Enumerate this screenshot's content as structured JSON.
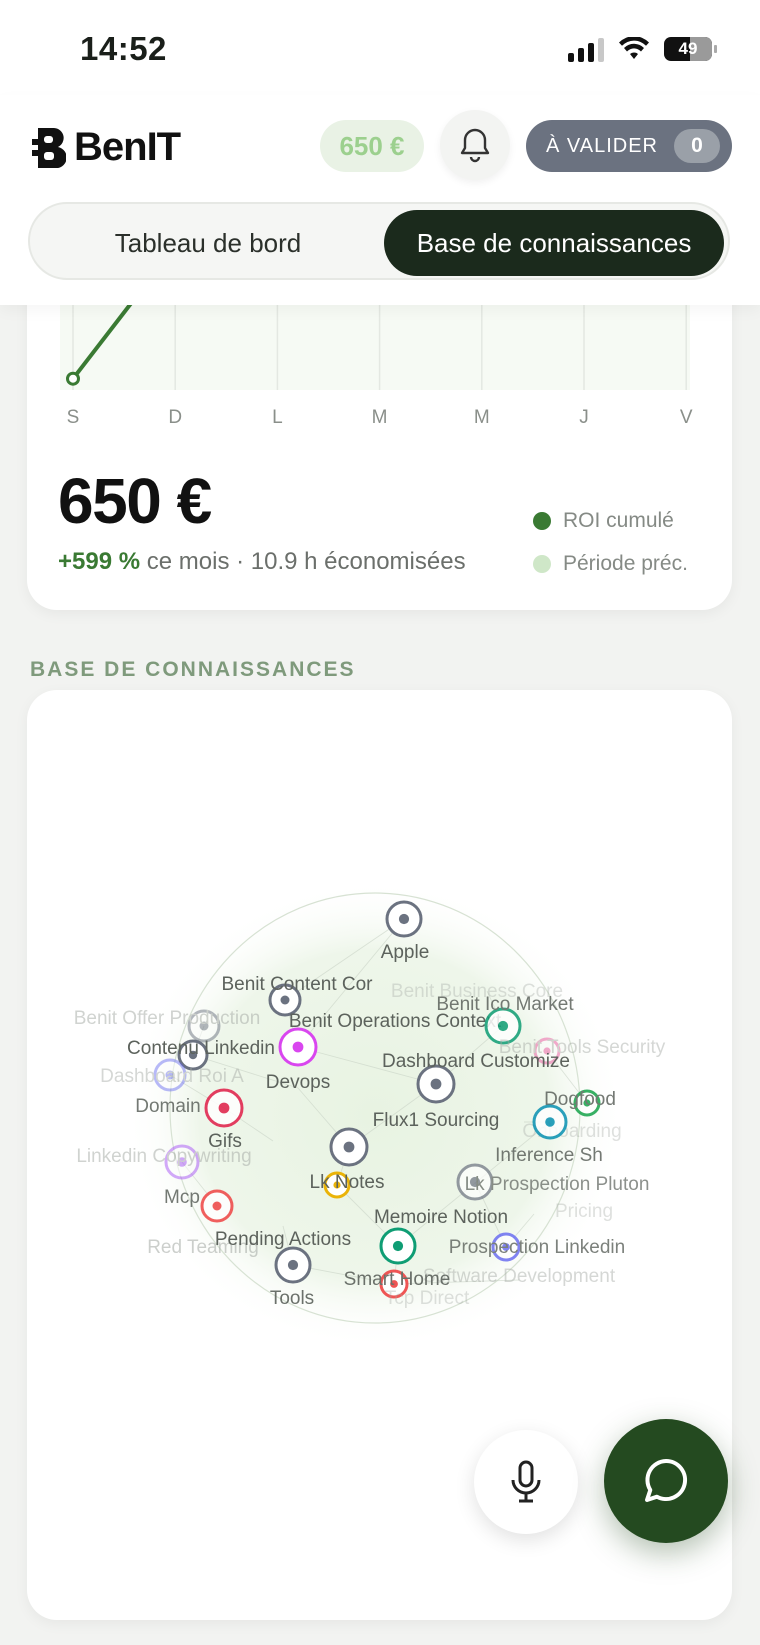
{
  "status_bar": {
    "time": "14:52",
    "battery": "49"
  },
  "header": {
    "app_name": "BenIT",
    "balance": "650 €",
    "validate_label": "À VALIDER",
    "validate_count": "0"
  },
  "tabs": [
    {
      "label": "Tableau de bord",
      "active": false
    },
    {
      "label": "Base de connaissances",
      "active": true
    }
  ],
  "roi": {
    "amount": "650 €",
    "delta": "+599 %",
    "delta_suffix": "ce mois · 10.9 h économisées",
    "legend": [
      {
        "label": "ROI cumulé",
        "color": "#3a7a33"
      },
      {
        "label": "Période préc.",
        "color": "#cfe7c8"
      }
    ],
    "chart_data": {
      "type": "line",
      "categories": [
        "S",
        "D",
        "L",
        "M",
        "M",
        "J",
        "V"
      ],
      "series": [
        {
          "name": "ROI cumulé",
          "values": [
            51,
            650,
            null,
            null,
            null,
            null,
            null
          ]
        }
      ],
      "ylim": [
        0,
        700
      ],
      "grid": true
    }
  },
  "knowledge": {
    "section_title": "BASE DE CONNAISSANCES",
    "nodes": [
      {
        "label": "Apple",
        "color": "#6b7280"
      },
      {
        "label": "Benit Content Cor",
        "color": "#6b7280"
      },
      {
        "label": "Benit Business Core",
        "color": "#9aa0a8"
      },
      {
        "label": "Benit Offer Production",
        "color": "#6b7280"
      },
      {
        "label": "Benit Operations Context",
        "color": "#d946ef"
      },
      {
        "label": "Benit Ico Market",
        "color": "#0f9d74"
      },
      {
        "label": "Contenu Linkedin",
        "color": "#6b7280"
      },
      {
        "label": "Benit Tools Security",
        "color": "#ec4899"
      },
      {
        "label": "Dashboard Roi A",
        "color": "#6366f1"
      },
      {
        "label": "Dashboard Customize",
        "color": "#6b7280"
      },
      {
        "label": "Devops",
        "color": "#d946ef"
      },
      {
        "label": "Domain",
        "color": "#e11d48"
      },
      {
        "label": "Dogfood",
        "color": "#16a34a"
      },
      {
        "label": "Flux1 Sourcing",
        "color": "#6b7280"
      },
      {
        "label": "Onboarding",
        "color": "#0ea5e9"
      },
      {
        "label": "Gifs",
        "color": "#6b7280"
      },
      {
        "label": "Linkedin Copywriting",
        "color": "#a855f7"
      },
      {
        "label": "Inference Sh",
        "color": "#0891b2"
      },
      {
        "label": "Lk Notes",
        "color": "#eab308"
      },
      {
        "label": "Lk Prospection Pluton",
        "color": "#6b7280"
      },
      {
        "label": "Mcp",
        "color": "#ef4444"
      },
      {
        "label": "Pricing",
        "color": "#7c3aed"
      },
      {
        "label": "Memoire Notion",
        "color": "#0f9d74"
      },
      {
        "label": "Red Teaming",
        "color": "#6b7280"
      },
      {
        "label": "Pending Actions",
        "color": "#6b7280"
      },
      {
        "label": "Prospection Linkedin",
        "color": "#6366f1"
      },
      {
        "label": "Software Development",
        "color": "#9aa0a8"
      },
      {
        "label": "Smart Home",
        "color": "#ef4444"
      },
      {
        "label": "Tools",
        "color": "#6b7280"
      },
      {
        "label": "Tcp Direct",
        "color": "#9aa0a8"
      }
    ]
  },
  "fab": {
    "mic_icon": "microphone-icon",
    "chat_icon": "chat-bubble-icon"
  }
}
